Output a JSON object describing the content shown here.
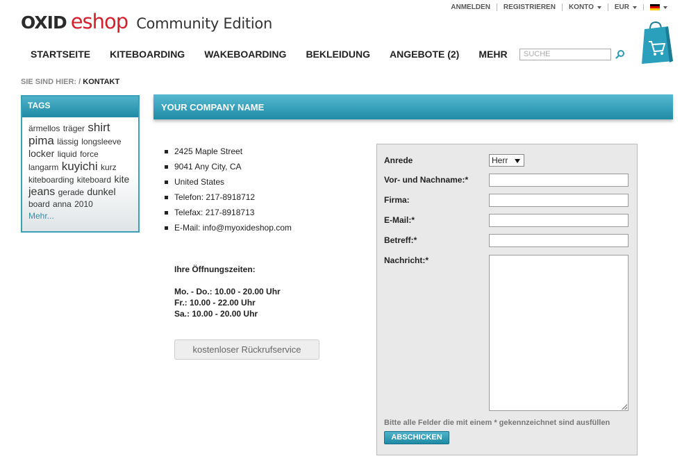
{
  "header": {
    "logo_oxid": "OXID",
    "logo_eshop": "eshop",
    "edition": "Community Edition",
    "links": {
      "login": "ANMELDEN",
      "register": "REGISTRIEREN",
      "account": "KONTO",
      "currency": "EUR"
    },
    "language_flag": "de-flag-icon"
  },
  "nav": {
    "items": [
      "STARTSEITE",
      "KITEBOARDING",
      "WAKEBOARDING",
      "BEKLEIDUNG",
      "ANGEBOTE (2)",
      "MEHR"
    ]
  },
  "search": {
    "placeholder": "SUCHE"
  },
  "breadcrumb": {
    "prefix": "SIE SIND HIER: /",
    "current": "KONTAKT"
  },
  "tags": {
    "title": "TAGS",
    "words": [
      "ärmellos",
      "träger",
      "shirt",
      "pima",
      "lässig",
      "longsleeve",
      "locker",
      "liquid",
      "force",
      "langarm",
      "kuyichi",
      "kurz",
      "kiteboarding",
      "kiteboard",
      "kite",
      "jeans",
      "gerade",
      "dunkel",
      "board",
      "anna",
      "2010"
    ],
    "more": "Mehr..."
  },
  "content": {
    "title": "YOUR COMPANY NAME",
    "address": [
      "2425 Maple Street",
      "9041 Any City, CA",
      "United States",
      "Telefon: 217-8918712",
      "Telefax: 217-8918713",
      "E-Mail: info@myoxideshop.com"
    ],
    "hours_title": "Ihre Öffnungszeiten:",
    "hours": [
      "Mo. - Do.: 10.00 - 20.00 Uhr",
      "Fr.: 10.00 - 22.00 Uhr",
      "Sa.: 10.00 - 20.00 Uhr"
    ],
    "callback_button": "kostenloser Rückrufservice"
  },
  "form": {
    "salutation_label": "Anrede",
    "salutation_value": "Herr",
    "name_label": "Vor- und Nachname:*",
    "company_label": "Firma:",
    "email_label": "E-Mail:*",
    "subject_label": "Betreff:*",
    "message_label": "Nachricht:*",
    "required_note": "Bitte alle Felder die mit einem * gekennzeichnet sind ausfüllen",
    "submit": "ABSCHICKEN"
  },
  "colors": {
    "accent": "#2b9bb5",
    "logo_red": "#d3202f",
    "form_bg": "#e9e9e9"
  }
}
